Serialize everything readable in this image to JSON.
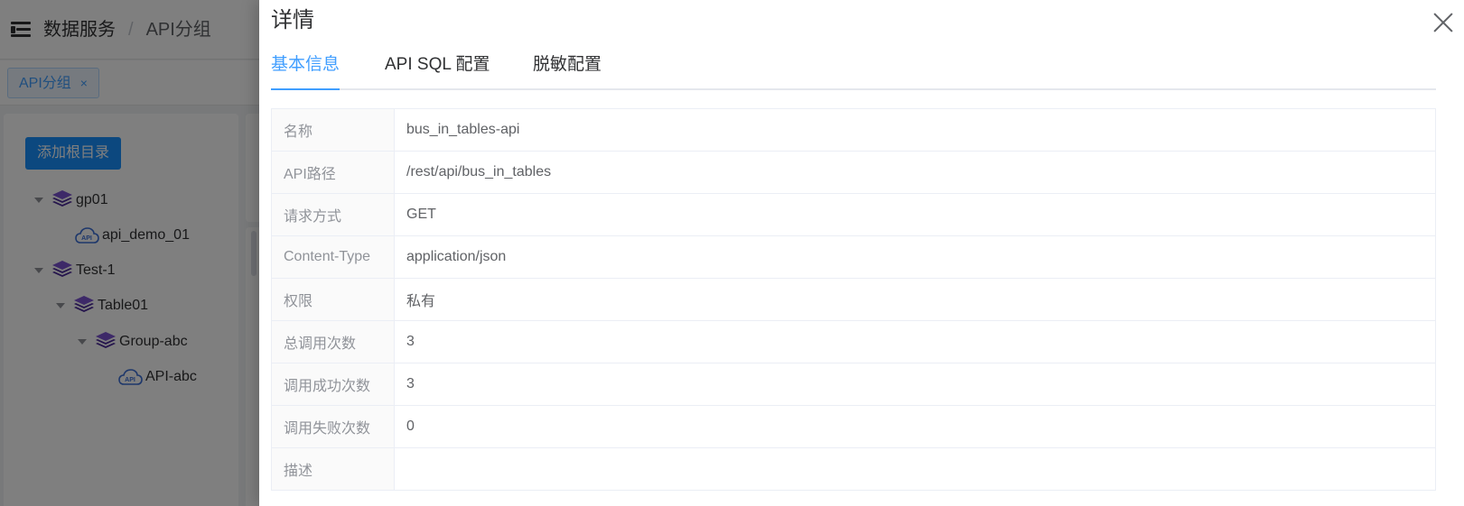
{
  "header": {
    "breadcrumb": [
      "数据服务",
      "API分组"
    ]
  },
  "tags_view": {
    "tags": [
      {
        "label": "API分组",
        "close": "×"
      }
    ]
  },
  "tree_panel": {
    "add_root_label": "添加根目录",
    "nodes": [
      {
        "label": "gp01",
        "type": "group",
        "expanded": true
      },
      {
        "label": "api_demo_01",
        "type": "api"
      },
      {
        "label": "Test-1",
        "type": "group",
        "expanded": true
      },
      {
        "label": "Table01",
        "type": "group",
        "expanded": true
      },
      {
        "label": "Group-abc",
        "type": "group",
        "expanded": true
      },
      {
        "label": "API-abc",
        "type": "api"
      }
    ],
    "api_icon_text": "API"
  },
  "drawer": {
    "title": "详情",
    "tabs": [
      {
        "label": "基本信息",
        "active": true
      },
      {
        "label": "API SQL 配置",
        "active": false
      },
      {
        "label": "脱敏配置",
        "active": false
      }
    ],
    "rows": [
      {
        "label": "名称",
        "value": "bus_in_tables-api"
      },
      {
        "label": "API路径",
        "value": "/rest/api/bus_in_tables"
      },
      {
        "label": "请求方式",
        "value": "GET"
      },
      {
        "label": "Content-Type",
        "value": "application/json"
      },
      {
        "label": "权限",
        "value": "私有"
      },
      {
        "label": "总调用次数",
        "value": "3"
      },
      {
        "label": "调用成功次数",
        "value": "3"
      },
      {
        "label": "调用失败次数",
        "value": "0"
      },
      {
        "label": "描述",
        "value": ""
      }
    ]
  },
  "colors": {
    "primary": "#409eff",
    "button": "#1890ff",
    "icon_purple": "#6a3fbf",
    "mask": "rgba(0,0,0,0.5)"
  }
}
